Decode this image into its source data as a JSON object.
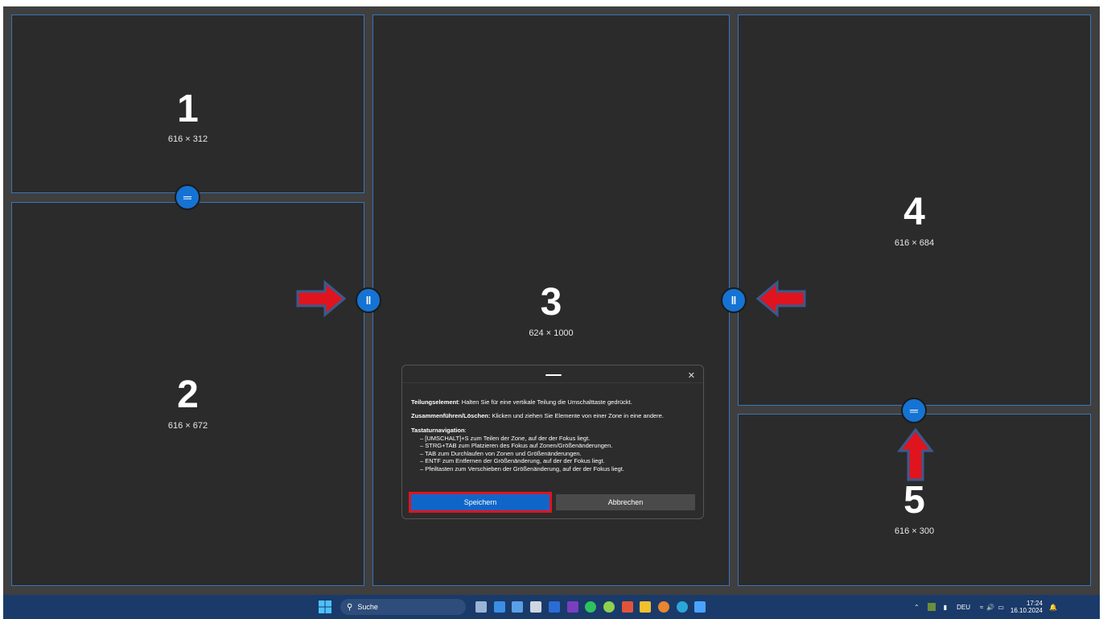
{
  "zones": [
    {
      "number": "1",
      "size": "616 × 312"
    },
    {
      "number": "2",
      "size": "616 × 672"
    },
    {
      "number": "3",
      "size": "624 × 1000"
    },
    {
      "number": "4",
      "size": "616 × 684"
    },
    {
      "number": "5",
      "size": "616 × 300"
    }
  ],
  "handles": {
    "horizontal_icon": "═",
    "vertical_icon": "‖"
  },
  "dialog": {
    "close_label": "✕",
    "split_title": "Teilungselement",
    "split_text": ": Halten Sie für eine vertikale Teilung die Umschalttaste gedrückt.",
    "merge_title": "Zusammenführen/Löschen:",
    "merge_text": " Klicken und ziehen Sie Elemente von einer Zone in eine andere.",
    "keyboard_title": "Tastaturnavigation",
    "keyboard_colon": ":",
    "keyboard_items": [
      "– [UMSCHALT]+S zum Teilen der Zone, auf der der Fokus liegt.",
      "– STRG+TAB zum Platzieren des Fokus auf Zonen/Größenänderungen.",
      "– TAB zum Durchlaufen von Zonen und Größenänderungen.",
      "– ENTF zum Entfernen der Größenänderung, auf der der Fokus liegt.",
      "– Pfeiltasten zum Verschieben der Größenänderung, auf der der Fokus liegt."
    ],
    "save_label": "Speichern",
    "cancel_label": "Abbrechen"
  },
  "taskbar": {
    "search_placeholder": "Suche",
    "language": "DEU",
    "time": "17:24",
    "date": "16.10.2024",
    "apps": [
      {
        "name": "task-view-icon",
        "color": "#9bb3d6"
      },
      {
        "name": "store-icon",
        "color": "#3a8ee6"
      },
      {
        "name": "notes-icon",
        "color": "#5aa0e8"
      },
      {
        "name": "document-icon",
        "color": "#d0d6df"
      },
      {
        "name": "word-icon",
        "color": "#2b6cd4"
      },
      {
        "name": "onenote-icon",
        "color": "#7a3fbf"
      },
      {
        "name": "whatsapp-icon",
        "color": "#2fc160"
      },
      {
        "name": "app-icon",
        "color": "#8fd14f"
      },
      {
        "name": "slides-icon",
        "color": "#e2543a"
      },
      {
        "name": "explorer-icon",
        "color": "#f2c12e"
      },
      {
        "name": "firefox-icon",
        "color": "#e9862f"
      },
      {
        "name": "edge-icon",
        "color": "#2aa7d8"
      },
      {
        "name": "fancyzones-icon",
        "color": "#4aa3ff"
      }
    ]
  }
}
